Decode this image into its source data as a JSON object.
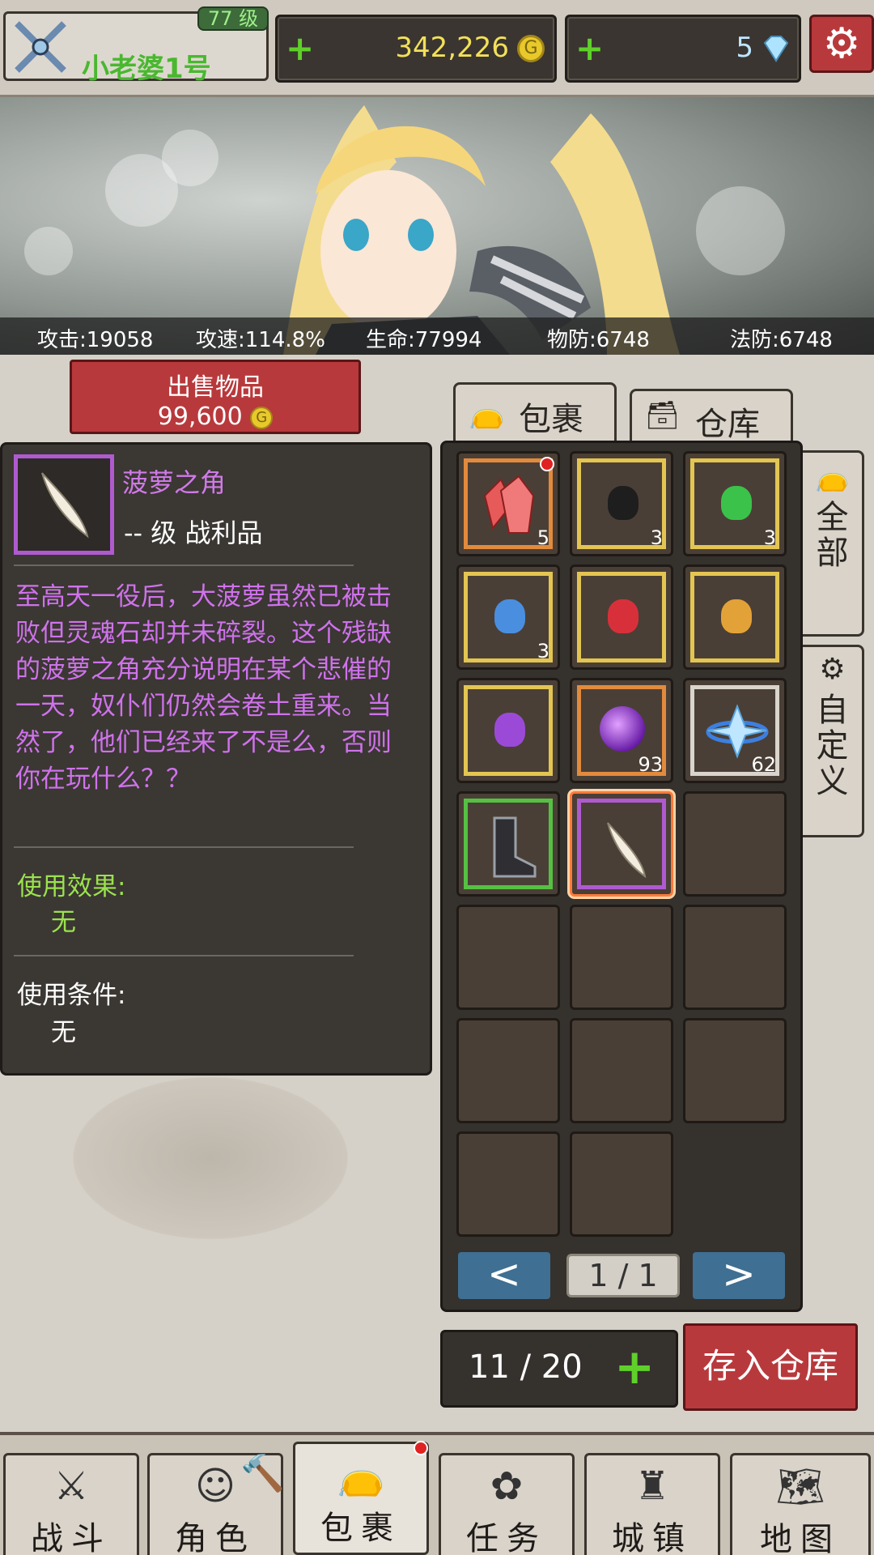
{
  "player": {
    "level": "77 级",
    "name": "小老婆1号"
  },
  "resources": {
    "gold": "342,226",
    "gems": "5",
    "plus": "+"
  },
  "stats": [
    "攻击:19058",
    "攻速:114.8%",
    "生命:77994",
    "物防:6748",
    "法防:6748"
  ],
  "sell": {
    "label": "出售物品",
    "price": "99,600"
  },
  "item": {
    "name": "菠萝之角",
    "type": "-- 级 战利品",
    "description": "至高天一役后，大菠萝虽然已被击败但灵魂石却并未碎裂。这个残缺的菠萝之角充分说明在某个悲催的一天，奴仆们仍然会卷土重来。当然了，他们已经来了不是么，否则你在玩什么？？",
    "use_effect_label": "使用效果:",
    "use_effect_value": "无",
    "use_condition_label": "使用条件:",
    "use_condition_value": "无"
  },
  "tabs": {
    "bag": "包裹",
    "warehouse": "仓库"
  },
  "side_tabs": {
    "all": "全部",
    "custom": "自定义"
  },
  "inventory": [
    {
      "item": "red-crystal",
      "rarity": "orange",
      "count": "5"
    },
    {
      "item": "black-ore",
      "rarity": "yellow",
      "count": "3"
    },
    {
      "item": "green-ore",
      "rarity": "yellow",
      "count": "3"
    },
    {
      "item": "blue-ore",
      "rarity": "yellow",
      "count": "3"
    },
    {
      "item": "red-ore",
      "rarity": "yellow",
      "count": ""
    },
    {
      "item": "orange-ore",
      "rarity": "yellow",
      "count": ""
    },
    {
      "item": "purple-ore",
      "rarity": "yellow",
      "count": ""
    },
    {
      "item": "purple-orb",
      "rarity": "orange",
      "count": "93"
    },
    {
      "item": "ice-crystal",
      "rarity": "white",
      "count": "62"
    },
    {
      "item": "boots",
      "rarity": "green",
      "count": ""
    },
    {
      "item": "horn",
      "rarity": "purple",
      "count": ""
    }
  ],
  "pager": {
    "prev": "<",
    "page": "1 / 1",
    "next": ">"
  },
  "capacity": "11 / 20",
  "deposit_label": "存入仓库",
  "nav": [
    "战斗",
    "角色",
    "包裹",
    "任务",
    "城镇",
    "地图"
  ],
  "colors": {
    "accent_red": "#b8393c",
    "gold_text": "#f2e05a",
    "purple_text": "#cf72ec",
    "green_text": "#9ae24d"
  }
}
